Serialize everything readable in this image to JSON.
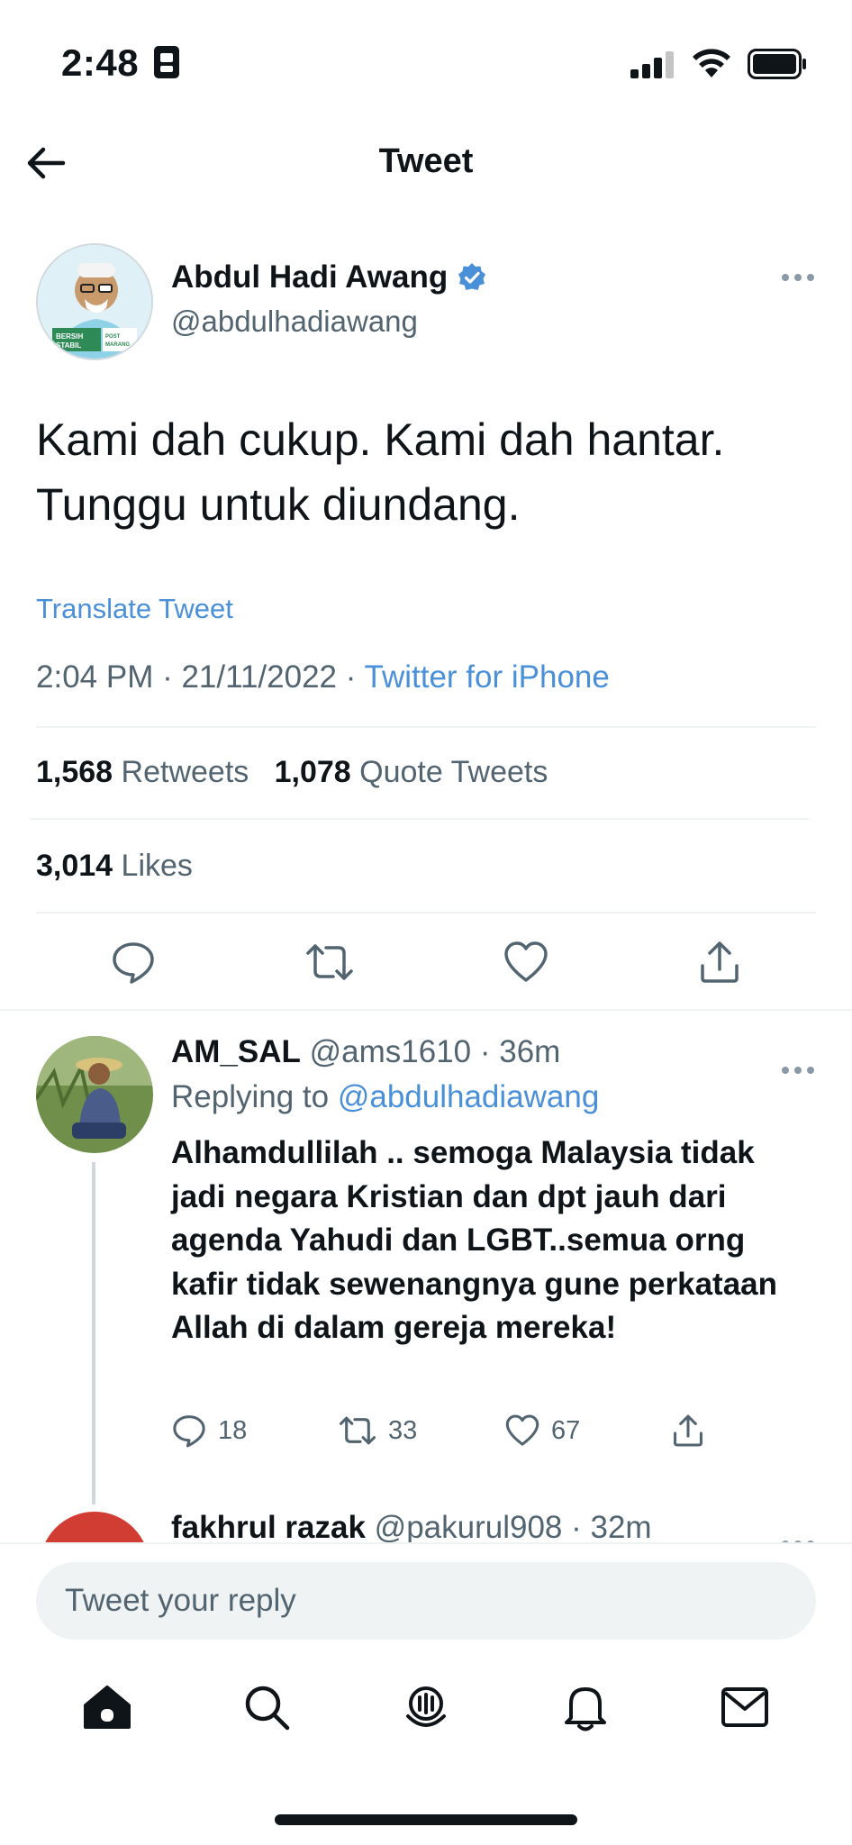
{
  "status_bar": {
    "time": "2:48",
    "battery": "full",
    "signal": "3-bars",
    "wifi": "on"
  },
  "header": {
    "title": "Tweet"
  },
  "tweet": {
    "author_name": "Abdul Hadi Awang",
    "author_handle": "@abdulhadiawang",
    "verified": true,
    "text": "Kami dah cukup. Kami dah hantar. Tunggu untuk diundang.",
    "translate_label": "Translate Tweet",
    "timestamp": "2:04 PM · 21/11/2022 · ",
    "source": "Twitter for iPhone",
    "retweets_count": "1,568",
    "retweets_label": "Retweets",
    "quotes_count": "1,078",
    "quotes_label": "Quote Tweets",
    "likes_count": "3,014",
    "likes_label": "Likes"
  },
  "avatar_badge": {
    "left_text": [
      "BERSIH",
      "STABIL"
    ],
    "right_text": [
      "POST",
      "MARANG"
    ]
  },
  "reply": {
    "name": "AM_SAL",
    "handle_time": "@ams1610 · 36m",
    "replying_prefix": "Replying to ",
    "replying_to": "@abdulhadiawang",
    "text": "Alhamdullilah .. semoga Malaysia tidak jadi negara Kristian dan dpt jauh dari agenda Yahudi dan LGBT..semua orng kafir tidak sewenangnya gune perkataan Allah di dalam gereja mereka!",
    "reply_count": "18",
    "retweet_count": "33",
    "like_count": "67"
  },
  "reply2": {
    "name": "fakhrul razak",
    "handle_time": "@pakurul908 · 32m"
  },
  "compose": {
    "placeholder": "Tweet your reply"
  },
  "colors": {
    "link": "#4a90d9",
    "verified": "#4a90d9",
    "muted": "#536471",
    "text": "#0f1419"
  }
}
